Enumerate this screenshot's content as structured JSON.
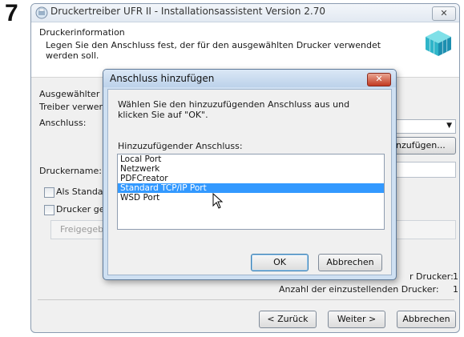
{
  "step_number": "7",
  "window": {
    "title": "Druckertreiber UFR II - Installationsassistent Version 2.70",
    "close_label": "✕"
  },
  "header": {
    "title": "Druckerinformation",
    "description": "Legen Sie den Anschluss fest, der für den ausgewählten Drucker verwendet werden soll."
  },
  "form": {
    "selected_label": "Ausgewählter",
    "driver_label": "Treiber verwer",
    "port_label": "Anschluss:",
    "add_port_button": "nzufügen...",
    "printer_name_label": "Druckername:",
    "default_checkbox_label": "Als Standar",
    "share_checkbox_label": "Drucker ger",
    "share_name_label": "Freigegebe",
    "count1_label": "r Drucker:",
    "count1_value": "1",
    "count2_label": "Anzahl der einzustellenden Drucker:",
    "count2_value": "1"
  },
  "nav": {
    "back": "< Zurück",
    "next": "Weiter >",
    "cancel": "Abbrechen"
  },
  "dialog": {
    "title": "Anschluss hinzufügen",
    "close_label": "✕",
    "instruction": "Wählen Sie den hinzuzufügenden Anschluss aus und klicken Sie auf \"OK\".",
    "list_label": "Hinzuzufügender Anschluss:",
    "ports": [
      "Local Port",
      "Netzwerk",
      "PDFCreator",
      "Standard TCP/IP Port",
      "WSD Port"
    ],
    "selected_port": "Standard TCP/IP Port",
    "ok": "OK",
    "cancel": "Abbrechen"
  }
}
